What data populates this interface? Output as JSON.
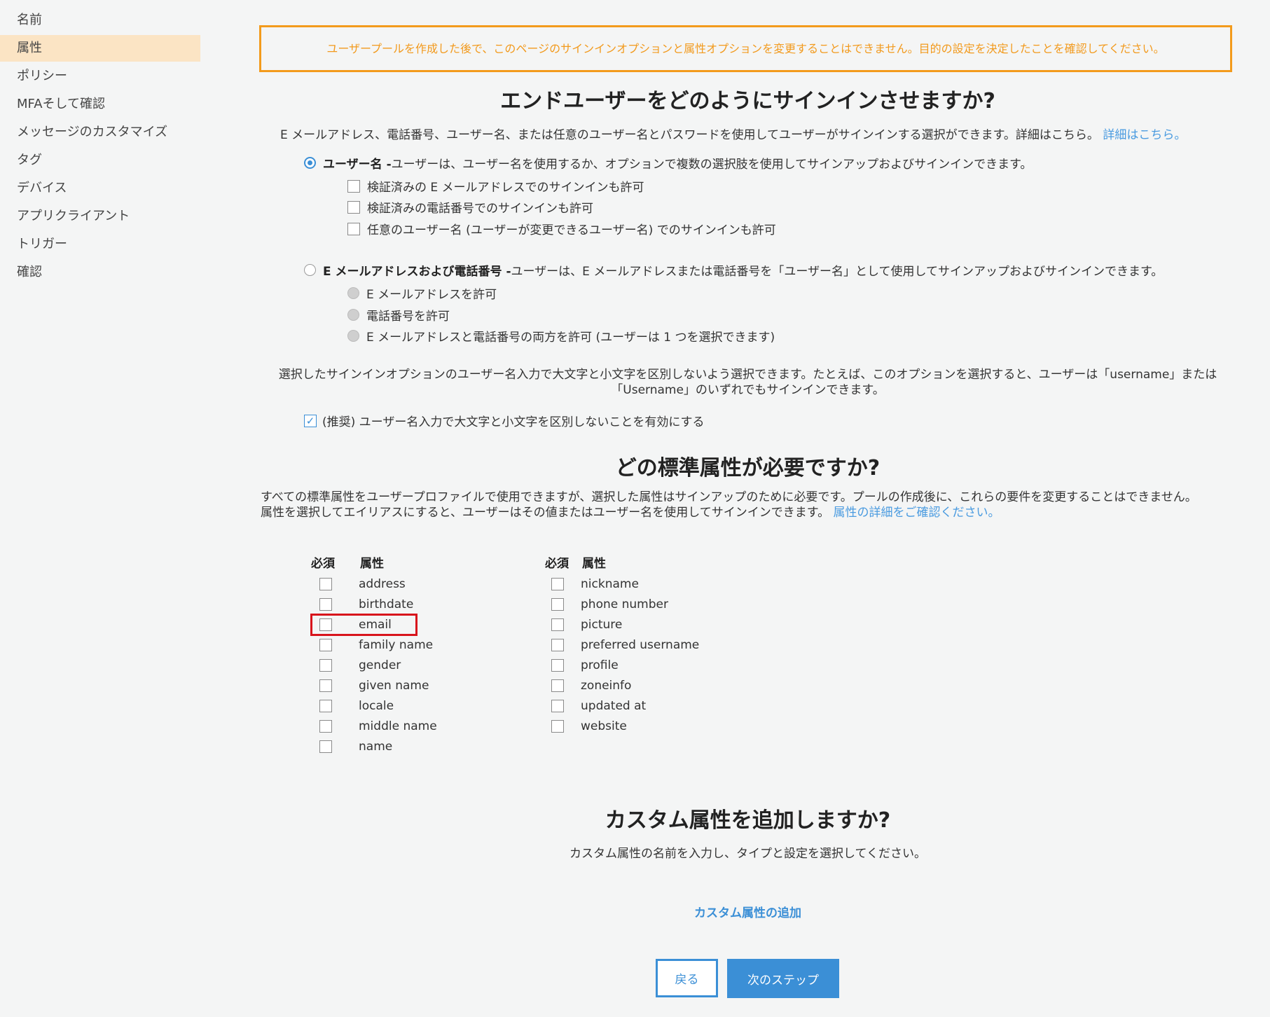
{
  "sidebar": {
    "items": [
      {
        "label": "名前"
      },
      {
        "label": "属性"
      },
      {
        "label": "ポリシー"
      },
      {
        "label": "MFAそして確認"
      },
      {
        "label": "メッセージのカスタマイズ"
      },
      {
        "label": "タグ"
      },
      {
        "label": "デバイス"
      },
      {
        "label": "アプリクライアント"
      },
      {
        "label": "トリガー"
      },
      {
        "label": "確認"
      }
    ],
    "active_index": 1
  },
  "warning": "ユーザープールを作成した後で、このページのサインインオプションと属性オプションを変更することはできません。目的の設定を決定したことを確認してください。",
  "signin": {
    "heading": "エンドユーザーをどのようにサインインさせますか?",
    "intro": "E メールアドレス、電話番号、ユーザー名、または任意のユーザー名とパスワードを使用してユーザーがサインインする選択ができます。詳細はこちら。",
    "intro_link": "詳細はこちら。",
    "option_username": {
      "title": "ユーザー名 -",
      "desc": " ユーザーは、ユーザー名を使用するか、オプションで複数の選択肢を使用してサインアップおよびサインインできます。",
      "selected": true,
      "sub": [
        {
          "label": "検証済みの E メールアドレスでのサインインも許可"
        },
        {
          "label": "検証済みの電話番号でのサインインも許可"
        },
        {
          "label": "任意のユーザー名 (ユーザーが変更できるユーザー名) でのサインインも許可"
        }
      ]
    },
    "option_email_phone": {
      "title": "E メールアドレスおよび電話番号 -",
      "desc": " ユーザーは、E メールアドレスまたは電話番号を「ユーザー名」として使用してサインアップおよびサインインできます。",
      "selected": false,
      "sub": [
        {
          "label": "E メールアドレスを許可"
        },
        {
          "label": "電話番号を許可"
        },
        {
          "label": "E メールアドレスと電話番号の両方を許可 (ユーザーは 1 つを選択できます)"
        }
      ]
    },
    "case_note_line1": "選択したサインインオプションのユーザー名入力で大文字と小文字を区別しないよう選択できます。たとえば、このオプションを選択すると、ユーザーは「username」または",
    "case_note_line2": "「Username」のいずれでもサインインできます。",
    "case_checkbox_label": "(推奨) ユーザー名入力で大文字と小文字を区別しないことを有効にする",
    "case_checked": true
  },
  "attributes": {
    "heading": "どの標準属性が必要ですか?",
    "desc_line1": "すべての標準属性をユーザープロファイルで使用できますが、選択した属性はサインアップのために必要です。プールの作成後に、これらの要件を変更することはできません。",
    "desc_line2": "属性を選択してエイリアスにすると、ユーザーはその値またはユーザー名を使用してサインインできます。",
    "desc_link": "属性の詳細をご確認ください。",
    "col_required": "必須",
    "col_attribute": "属性",
    "left": [
      {
        "name": "address",
        "required": false
      },
      {
        "name": "birthdate",
        "required": false
      },
      {
        "name": "email",
        "required": false
      },
      {
        "name": "family name",
        "required": false
      },
      {
        "name": "gender",
        "required": false
      },
      {
        "name": "given name",
        "required": false
      },
      {
        "name": "locale",
        "required": false
      },
      {
        "name": "middle name",
        "required": false
      },
      {
        "name": "name",
        "required": false
      }
    ],
    "right": [
      {
        "name": "nickname",
        "required": false
      },
      {
        "name": "phone number",
        "required": false
      },
      {
        "name": "picture",
        "required": false
      },
      {
        "name": "preferred username",
        "required": false
      },
      {
        "name": "profile",
        "required": false
      },
      {
        "name": "zoneinfo",
        "required": false
      },
      {
        "name": "updated at",
        "required": false
      },
      {
        "name": "website",
        "required": false
      }
    ]
  },
  "custom": {
    "heading": "カスタム属性を追加しますか?",
    "desc": "カスタム属性の名前を入力し、タイプと設定を選択してください。",
    "add_label": "カスタム属性の追加"
  },
  "buttons": {
    "back": "戻る",
    "next": "次のステップ"
  },
  "colors": {
    "accent": "#3b8fd6",
    "warning": "#f29a1d",
    "active_nav": "#fbe4c4",
    "highlight": "#d8141c"
  }
}
